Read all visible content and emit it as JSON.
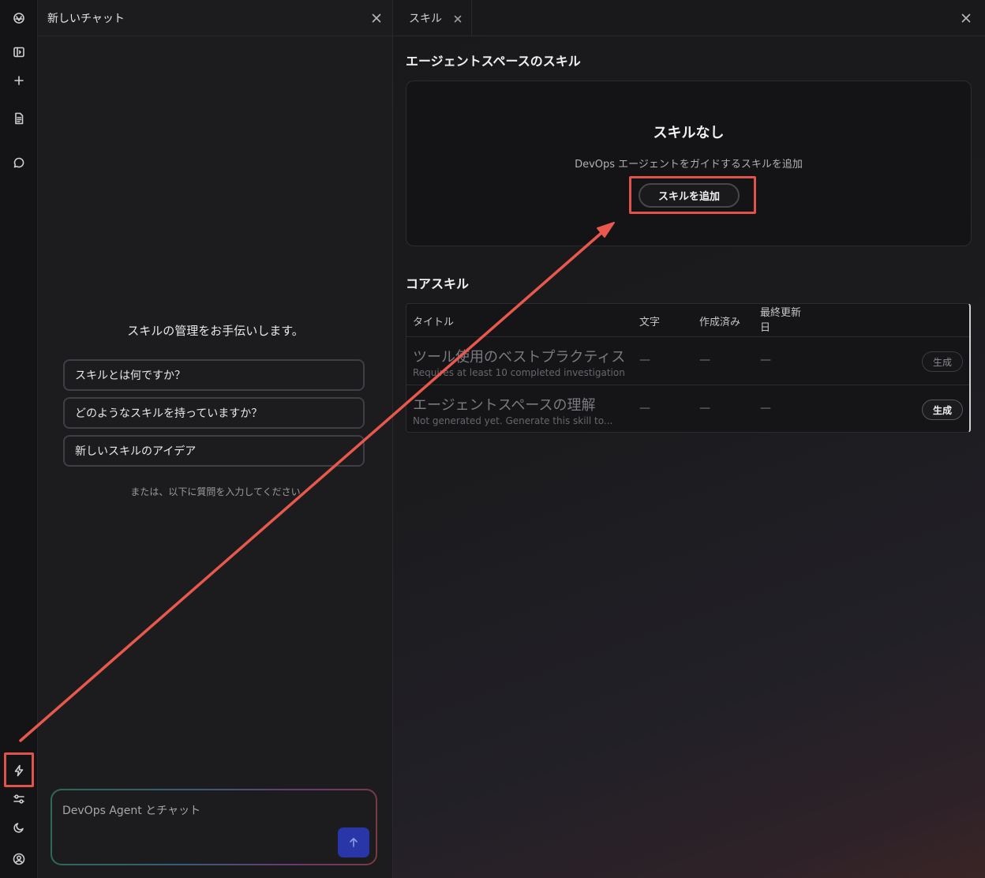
{
  "rail": {
    "icons": [
      "logo-icon",
      "sidebar-toggle-icon",
      "plus-icon",
      "document-icon",
      "chat-bubble-icon",
      "lightning-icon",
      "sliders-icon",
      "moon-icon",
      "user-circle-icon"
    ]
  },
  "chat": {
    "title": "新しいチャット",
    "welcome": "スキルの管理をお手伝いします。",
    "suggestions": [
      "スキルとは何ですか？",
      "どのようなスキルを持っていますか？",
      "新しいスキルのアイデア"
    ],
    "or_text": "または、以下に質問を入力してください",
    "input_placeholder": "DevOps Agent とチャット"
  },
  "skills_panel": {
    "tab_label": "スキル",
    "agent_space_heading": "エージェントスペースのスキル",
    "empty_title": "スキルなし",
    "empty_desc": "DevOps エージェントをガイドするスキルを追加",
    "add_button": "スキルを追加",
    "core_heading": "コアスキル",
    "columns": [
      "タイトル",
      "文字",
      "作成済み",
      "最終更新日"
    ],
    "rows": [
      {
        "title": "ツール使用のベストプラクティス",
        "subtitle": "Requires at least 10 completed investigations...",
        "chars": "—",
        "created": "—",
        "updated": "—",
        "action": "生成",
        "action_enabled": false
      },
      {
        "title": "エージェントスペースの理解",
        "subtitle": "Not generated yet. Generate this skill to...",
        "chars": "—",
        "created": "—",
        "updated": "—",
        "action": "生成",
        "action_enabled": true
      }
    ]
  },
  "colors": {
    "highlight": "#e0534a",
    "send_button": "#2836a8"
  }
}
